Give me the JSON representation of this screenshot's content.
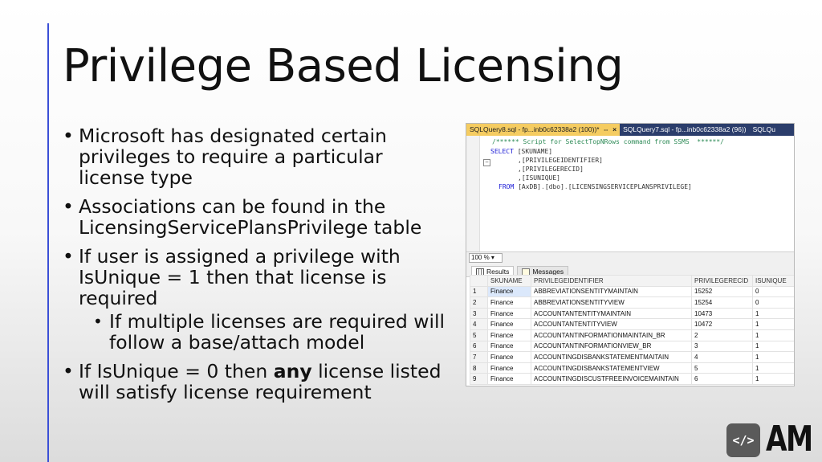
{
  "slide": {
    "title": "Privilege Based Licensing",
    "bullets": {
      "b1": "Microsoft has designated certain privileges to require a particular license type",
      "b2": "Associations can be found in the LicensingServicePlansPrivilege table",
      "b3": "If user is assigned a privilege with IsUnique = 1 then that license is required",
      "b3_sub": "If multiple licenses are required will follow a base/attach model",
      "b4_pre": "If IsUnique = 0 then ",
      "b4_bold": "any",
      "b4_post": " license listed will satisfy license requirement"
    },
    "bullet_glyph": "•"
  },
  "ssms": {
    "tabs": [
      {
        "label": "SQLQuery8.sql - fp...inb0c62338a2 (100))*",
        "pin": "⇔",
        "close": "×"
      },
      {
        "label": "SQLQuery7.sql - fp...inb0c62338a2 (96))"
      },
      {
        "label": "SQLQu"
      }
    ],
    "code": {
      "comment": "/****** Script for SelectTopNRows command from SSMS  ******/",
      "select_kw": "SELECT",
      "col1": "[SKUNAME]",
      "col2": ",[PRIVILEGEIDENTIFIER]",
      "col3": ",[PRIVILEGERECID]",
      "col4": ",[ISUNIQUE]",
      "from_kw": "FROM",
      "from_db": "[AxDB]",
      "from_schema": "[dbo]",
      "from_table": "[LICENSINGSERVICEPLANSPRIVILEGE]",
      "dot": "."
    },
    "zoom": "100 %",
    "result_tabs": {
      "results": "Results",
      "messages": "Messages"
    },
    "columns": [
      "",
      "SKUNAME",
      "PRIVILEGEIDENTIFIER",
      "PRIVILEGERECID",
      "ISUNIQUE"
    ],
    "rows": [
      [
        "1",
        "Finance",
        "ABBREVIATIONSENTITYMAINTAIN",
        "15252",
        "0"
      ],
      [
        "2",
        "Finance",
        "ABBREVIATIONSENTITYVIEW",
        "15254",
        "0"
      ],
      [
        "3",
        "Finance",
        "ACCOUNTANTENTITYMAINTAIN",
        "10473",
        "1"
      ],
      [
        "4",
        "Finance",
        "ACCOUNTANTENTITYVIEW",
        "10472",
        "1"
      ],
      [
        "5",
        "Finance",
        "ACCOUNTANTINFORMATIONMAINTAIN_BR",
        "2",
        "1"
      ],
      [
        "6",
        "Finance",
        "ACCOUNTANTINFORMATIONVIEW_BR",
        "3",
        "1"
      ],
      [
        "7",
        "Finance",
        "ACCOUNTINGDISBANKSTATEMENTMAITAIN",
        "4",
        "1"
      ],
      [
        "8",
        "Finance",
        "ACCOUNTINGDISBANKSTATEMENTVIEW",
        "5",
        "1"
      ],
      [
        "9",
        "Finance",
        "ACCOUNTINGDISCUSTFREEINVOICEMAINTAIN",
        "6",
        "1"
      ]
    ]
  },
  "logo": {
    "icon_text": "</>",
    "text": "AM"
  },
  "colors": {
    "accent_line": "#3b4fd6",
    "ssms_tabbar": "#2b3d6b",
    "active_tab": "#f5cc61"
  }
}
